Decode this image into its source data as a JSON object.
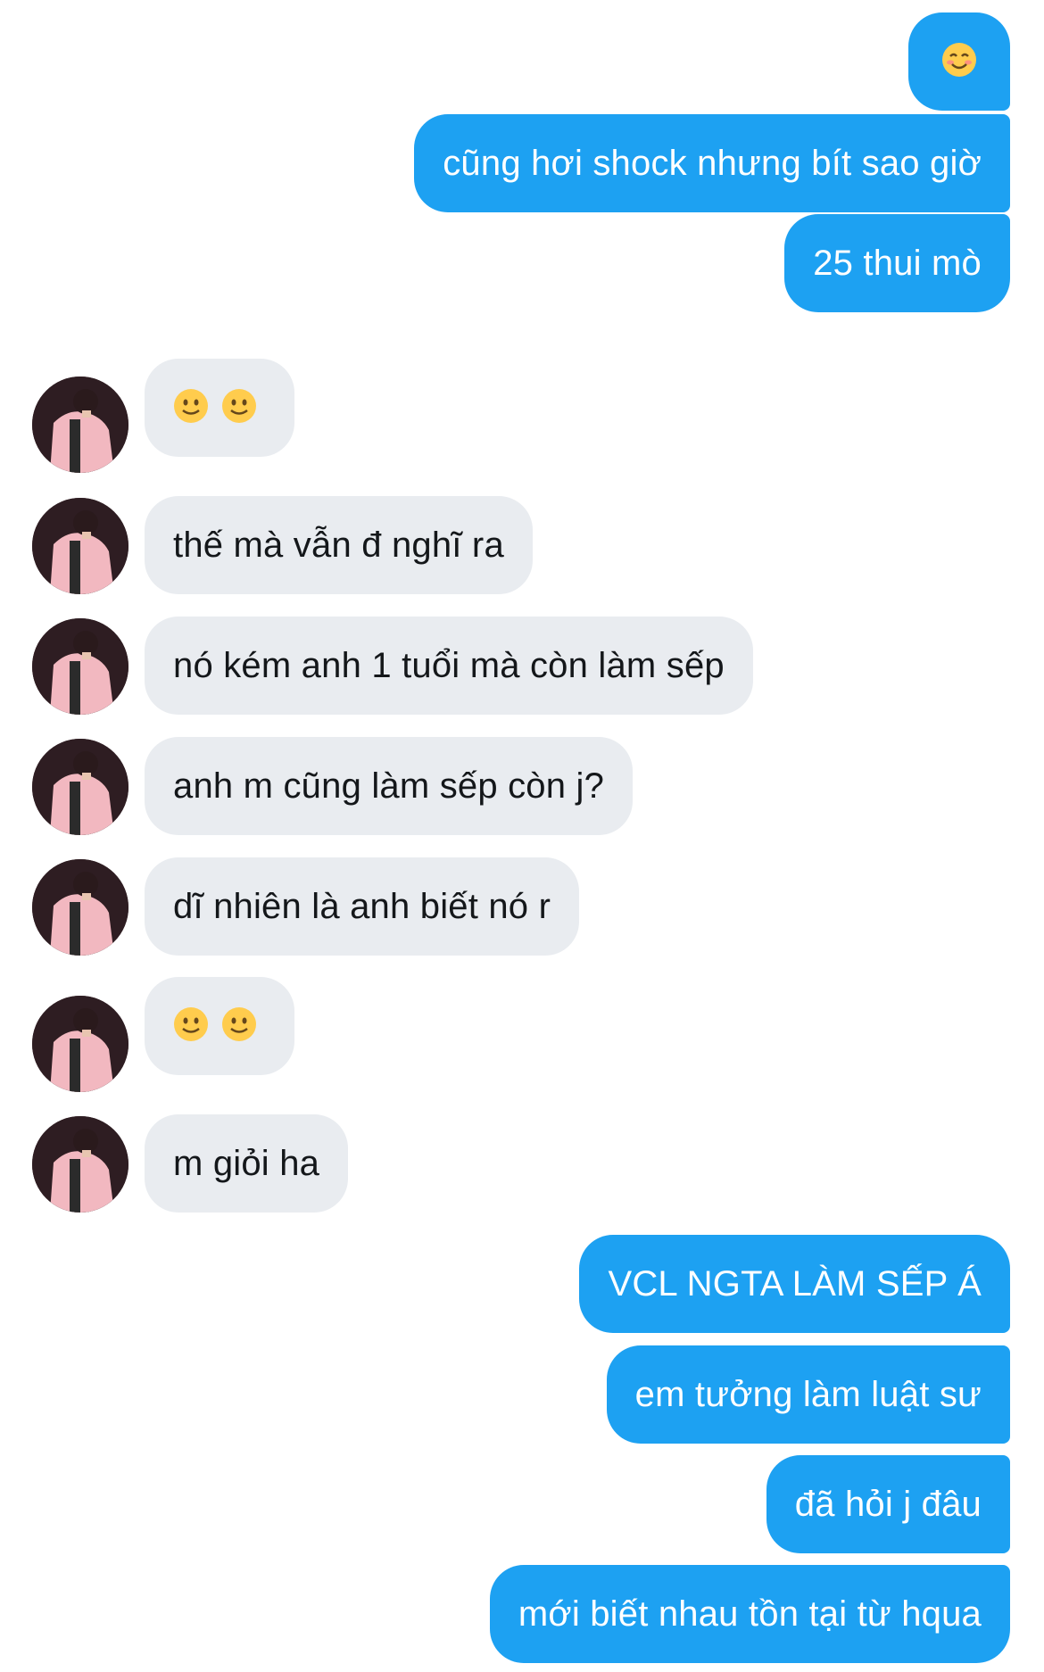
{
  "conversation": {
    "messages": [
      {
        "side": "out",
        "text": "☺️"
      },
      {
        "side": "out",
        "text": "cũng hơi shock nhưng bít sao giờ"
      },
      {
        "side": "out",
        "text": "25 thui mò"
      },
      {
        "side": "in",
        "text": "🙂🙂"
      },
      {
        "side": "in",
        "text": "thế mà vẫn đ nghĩ ra"
      },
      {
        "side": "in",
        "text": "nó kém anh 1 tuổi mà còn làm sếp"
      },
      {
        "side": "in",
        "text": "anh m cũng làm sếp còn j?"
      },
      {
        "side": "in",
        "text": "dĩ nhiên là anh biết nó r"
      },
      {
        "side": "in",
        "text": "🙂🙂"
      },
      {
        "side": "in",
        "text": "m giỏi ha"
      },
      {
        "side": "out",
        "text": "VCL NGTA LÀM SẾP Á"
      },
      {
        "side": "out",
        "text": "em tưởng làm luật sư"
      },
      {
        "side": "out",
        "text": "đã hỏi j đâu"
      },
      {
        "side": "out",
        "text": "mới biết nhau tồn tại từ hqua"
      }
    ]
  },
  "contact": {
    "avatar_icon": "contact-avatar-photo"
  },
  "colors": {
    "outgoing_bubble": "#1da1f2",
    "incoming_bubble": "#e9ecf0"
  }
}
